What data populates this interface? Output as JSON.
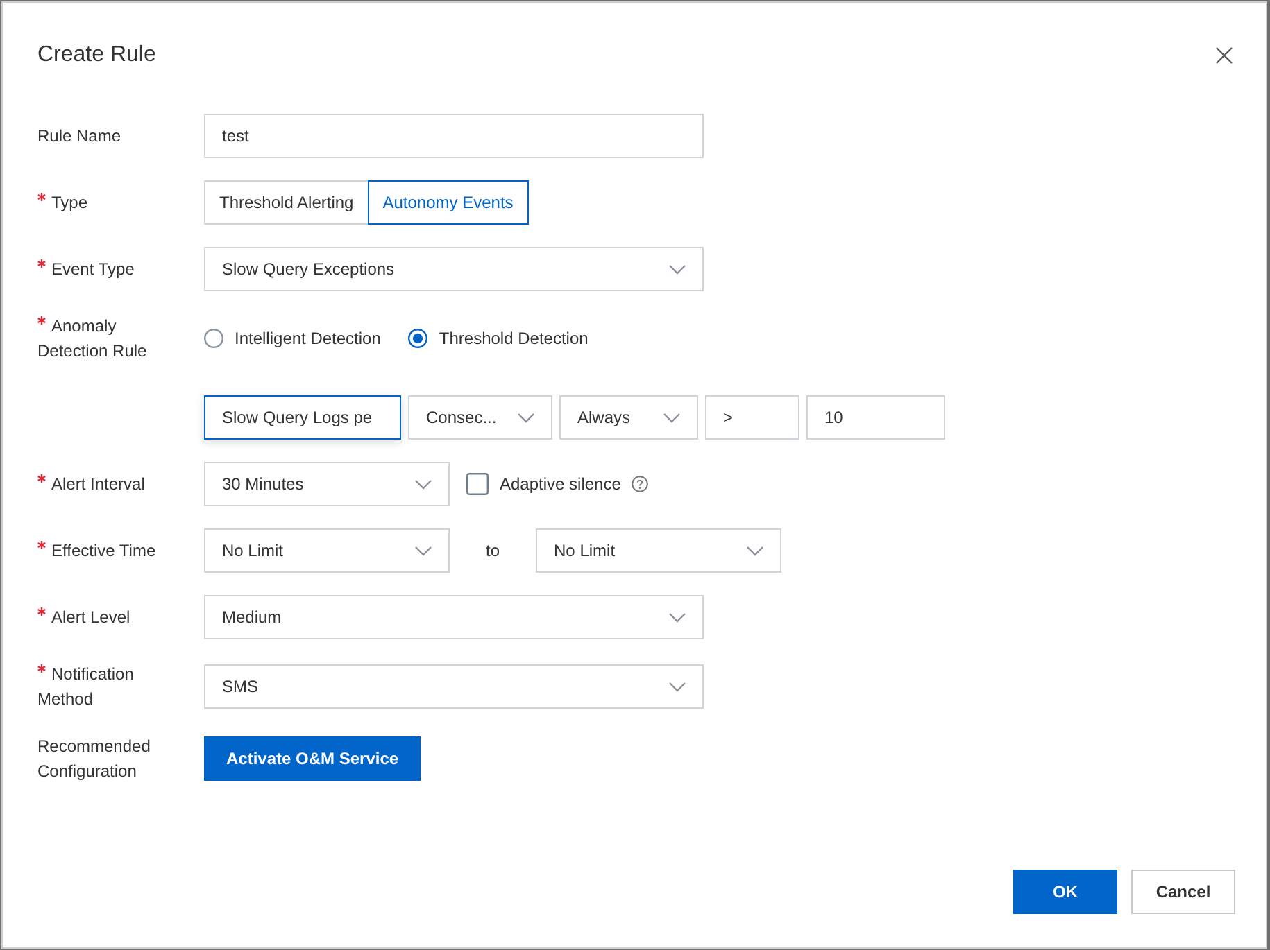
{
  "dialog": {
    "title": "Create Rule"
  },
  "fields": [
    {
      "kind": "text",
      "label": "Rule Name",
      "required": false,
      "value": "test"
    },
    {
      "kind": "segmented",
      "label": "Type",
      "required": true,
      "options": [
        {
          "label": "Threshold Alerting",
          "selected": false
        },
        {
          "label": "Autonomy Events",
          "selected": true
        }
      ]
    },
    {
      "kind": "select",
      "label": "Event Type",
      "required": true,
      "value": "Slow Query Exceptions"
    },
    {
      "kind": "radio",
      "label": "Anomaly Detection Rule",
      "required": true,
      "options": [
        {
          "label": "Intelligent Detection",
          "selected": false
        },
        {
          "label": "Threshold Detection",
          "selected": true
        }
      ]
    },
    {
      "kind": "condition",
      "controls": [
        {
          "kind": "input",
          "value": "Slow Query Logs pe",
          "focused": true
        },
        {
          "kind": "select",
          "value": "Consec..."
        },
        {
          "kind": "select",
          "value": "Always"
        },
        {
          "kind": "input",
          "value": ">",
          "focused": false
        },
        {
          "kind": "input",
          "value": "10",
          "focused": false
        }
      ]
    },
    {
      "kind": "select_check",
      "label": "Alert Interval",
      "required": true,
      "value": "30 Minutes",
      "checkbox": {
        "label": "Adaptive silence",
        "checked": false
      }
    },
    {
      "kind": "range",
      "label": "Effective Time",
      "required": true,
      "from": "No Limit",
      "separator": "to",
      "to": "No Limit"
    },
    {
      "kind": "select",
      "label": "Alert Level",
      "required": true,
      "value": "Medium"
    },
    {
      "kind": "select",
      "label": "Notification Method",
      "required": true,
      "value": "SMS"
    },
    {
      "kind": "action",
      "label": "Recommended Configuration",
      "required": false,
      "button": "Activate O&M Service"
    }
  ],
  "footer": {
    "buttons": [
      {
        "label": "OK",
        "kind": "primary"
      },
      {
        "label": "Cancel",
        "kind": "default"
      }
    ]
  }
}
